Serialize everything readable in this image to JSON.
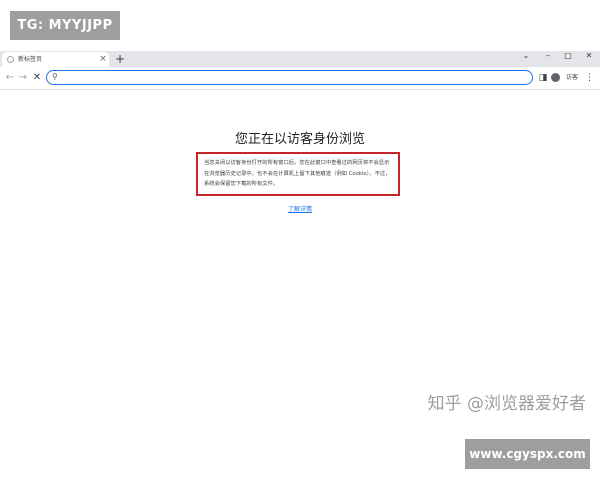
{
  "watermarks": {
    "top_badge": "TG: MYYJJPP",
    "zhihu": "知乎 @浏览器爱好者",
    "site": "www.cgyspx.com"
  },
  "browser": {
    "tab": {
      "title": "新标签页",
      "close_glyph": "×",
      "icon": "globe-icon"
    },
    "new_tab_glyph": "+",
    "window_controls": {
      "dropdown_glyph": "⌄",
      "minimize_glyph": "–",
      "maximize_glyph": "□",
      "close_glyph": "✕"
    },
    "toolbar": {
      "back_glyph": "←",
      "forward_glyph": "→",
      "reload_glyph": "✕",
      "search_glyph": "⚲",
      "omnibox_value": "",
      "sidebar_glyph": "◨",
      "profile_label": "访客",
      "menu_glyph": "⋮"
    },
    "accent_color": "#1a73e8"
  },
  "content": {
    "heading": "您正在以访客身份浏览",
    "description": "当您关闭以访客身份打开的所有窗口后，您在此窗口中查看过的网页将不会显示在浏览器历史记录中，也不会在计算机上留下其他痕迹（例如 Cookie）。不过，系统会保留您下载的所有文件。",
    "highlight_color": "#c6242b",
    "learn_more": "了解详情"
  }
}
